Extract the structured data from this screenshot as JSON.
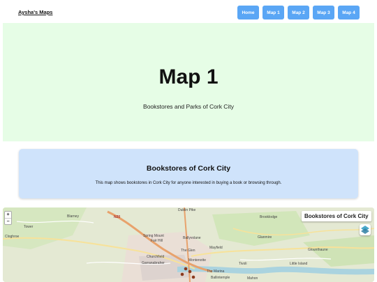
{
  "nav": {
    "brand": "Aysha's Maps",
    "buttons": [
      "Home",
      "Map 1",
      "Map 2",
      "Map 3",
      "Map 4"
    ]
  },
  "hero": {
    "title": "Map 1",
    "subtitle": "Bookstores and Parks of Cork City"
  },
  "card": {
    "title": "Bookstores of Cork City",
    "text": "This map shows bookstores in Cork City for anyone interested in buying a book or browsing through."
  },
  "map": {
    "label": "Bookstores of Cork City",
    "zoom_in": "+",
    "zoom_out": "−",
    "places": {
      "blarney": "Blarney",
      "n20": "N20",
      "dublin_pike": "Dublin Pike",
      "brooklodge": "Brooklodge",
      "tower": "Tower",
      "cloghroe": "Cloghroe",
      "spring_mount": "Spring Mount",
      "fair_hill": "Fair Hill",
      "ballyvolane": "Ballyvolane",
      "glanmire": "Glanmire",
      "the_glen": "The Glen",
      "mayfield": "Mayfield",
      "churchfield": "Churchfield",
      "garranabraher": "Garranabraher",
      "montenotte": "Montenotte",
      "glounthaune": "Glounthaune",
      "tivoli": "Tivoli",
      "little_island": "Little Island",
      "the_marina": "The Marina",
      "ballintemple": "Ballintemple",
      "mahon": "Mahon"
    },
    "colors": {
      "water": "#aad3df",
      "park": "#cde6b5",
      "major_road": "#e8a26c",
      "minor_road": "#f7e29a",
      "marker": "#8b3a1e"
    }
  }
}
